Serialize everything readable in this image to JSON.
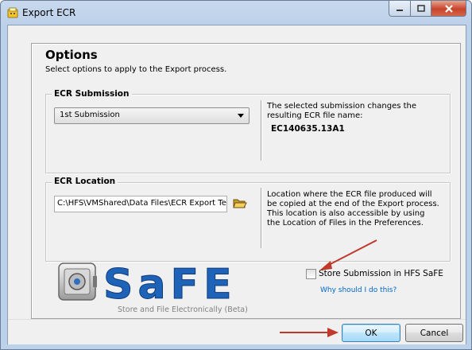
{
  "window": {
    "title": "Export ECR",
    "title_icon": "yellow-folder-icon"
  },
  "options": {
    "title": "Options",
    "subtitle": "Select options to apply to the Export process."
  },
  "submission": {
    "group_title": "ECR Submission",
    "selected": "1st Submission",
    "info": "The selected submission changes the resulting ECR file name:",
    "file_name": "EC140635.13A1"
  },
  "location": {
    "group_title": "ECR Location",
    "path": "C:\\HFS\\VMShared\\Data Files\\ECR Export Te",
    "info": "Location where the ECR file produced will be copied at the end of the Export process. This location is also accessible by using the Location of Files in the Preferences."
  },
  "safe": {
    "logo_text": "SaFE",
    "tagline": "Store and File Electronically (Beta)",
    "checkbox_label": "Store Submission in HFS SaFE",
    "checkbox_checked": false,
    "help_link": "Why should I do this?"
  },
  "buttons": {
    "ok": "OK",
    "cancel": "Cancel"
  },
  "colors": {
    "accent_arrow": "#c0392b",
    "safe_blue": "#1f63b8",
    "link": "#0066cc"
  }
}
